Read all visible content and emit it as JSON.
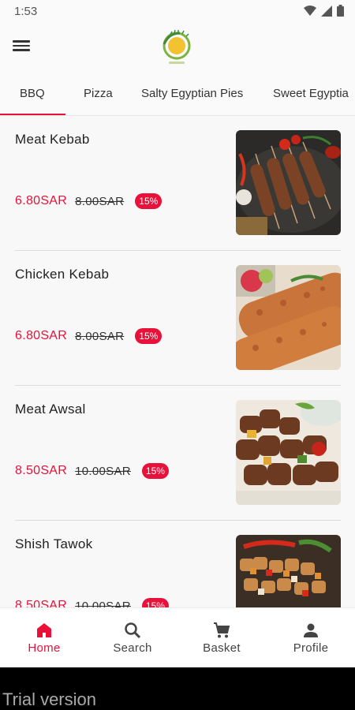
{
  "status_bar": {
    "time": "1:53"
  },
  "header": {
    "menu_icon": "hamburger-icon",
    "logo_icon": "restaurant-logo"
  },
  "tabs": [
    {
      "label": "BBQ",
      "active": true
    },
    {
      "label": "Pizza",
      "active": false
    },
    {
      "label": "Salty Egyptian Pies",
      "active": false
    },
    {
      "label": "Sweet Egyptia",
      "active": false
    }
  ],
  "items": [
    {
      "name": "Meat Kebab",
      "price": "6.80SAR",
      "old_price": "8.00SAR",
      "discount": "15%",
      "image_icon": "meat-kebab-photo"
    },
    {
      "name": "Chicken Kebab",
      "price": "6.80SAR",
      "old_price": "8.00SAR",
      "discount": "15%",
      "image_icon": "chicken-kebab-photo"
    },
    {
      "name": "Meat Awsal",
      "price": "8.50SAR",
      "old_price": "10.00SAR",
      "discount": "15%",
      "image_icon": "meat-awsal-photo"
    },
    {
      "name": "Shish Tawok",
      "price": "8.50SAR",
      "old_price": "10.00SAR",
      "discount": "15%",
      "image_icon": "shish-tawok-photo"
    }
  ],
  "bottom_nav": [
    {
      "label": "Home",
      "icon": "home-icon",
      "active": true
    },
    {
      "label": "Search",
      "icon": "search-icon",
      "active": false
    },
    {
      "label": "Basket",
      "icon": "cart-icon",
      "active": false
    },
    {
      "label": "Profile",
      "icon": "person-icon",
      "active": false
    }
  ],
  "trial": {
    "text": "Trial version"
  },
  "colors": {
    "accent": "#e8113a",
    "background": "#f8f8f8"
  }
}
